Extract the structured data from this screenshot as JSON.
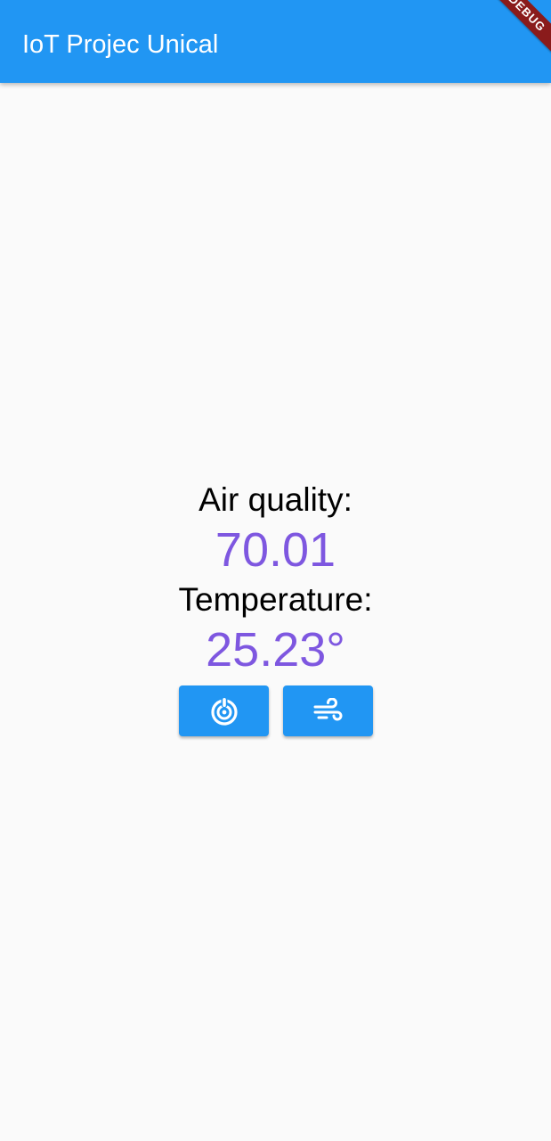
{
  "app_bar": {
    "title": "IoT Projec Unical",
    "debug_banner": "DEBUG",
    "color": "#2196f3"
  },
  "readings": {
    "air_quality_label": "Air quality:",
    "air_quality_value": "70.01",
    "temperature_label": "Temperature:",
    "temperature_value": "25.23°",
    "value_color": "#7e57e0"
  },
  "buttons": [
    {
      "icon": "power-target-icon"
    },
    {
      "icon": "wind-icon"
    }
  ]
}
